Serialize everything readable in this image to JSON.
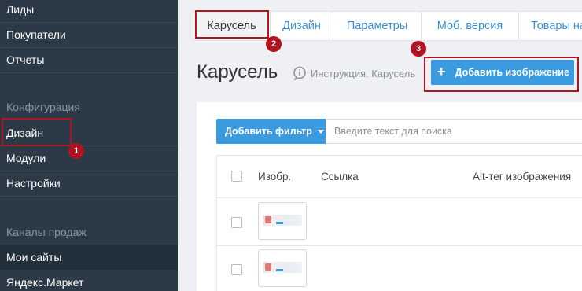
{
  "sidebar": {
    "items_top": [
      "Лиды",
      "Покупатели",
      "Отчеты"
    ],
    "section_config": "Конфигурация",
    "items_config": [
      "Дизайн",
      "Модули",
      "Настройки"
    ],
    "section_channels": "Каналы продаж",
    "items_channels": [
      "Мои сайты",
      "Яндекс.Маркет"
    ]
  },
  "tabs": [
    "Карусель",
    "Дизайн",
    "Параметры",
    "Моб. версия",
    "Товары на"
  ],
  "page": {
    "title": "Карусель",
    "instruction": "Инструкция. Карусель",
    "add_button": "Добавить изображение",
    "add_button_icon": "+"
  },
  "filter": {
    "button_label": "Добавить фильтр",
    "search_placeholder": "Введите текст для поиска"
  },
  "table": {
    "columns": [
      "Изобр.",
      "Ссылка",
      "Alt-тег изображения"
    ]
  },
  "annotations": [
    "1",
    "2",
    "3"
  ],
  "colors": {
    "accent": "#3a9be0",
    "sidebar": "#2c3a47",
    "annotation": "#b3121f"
  }
}
